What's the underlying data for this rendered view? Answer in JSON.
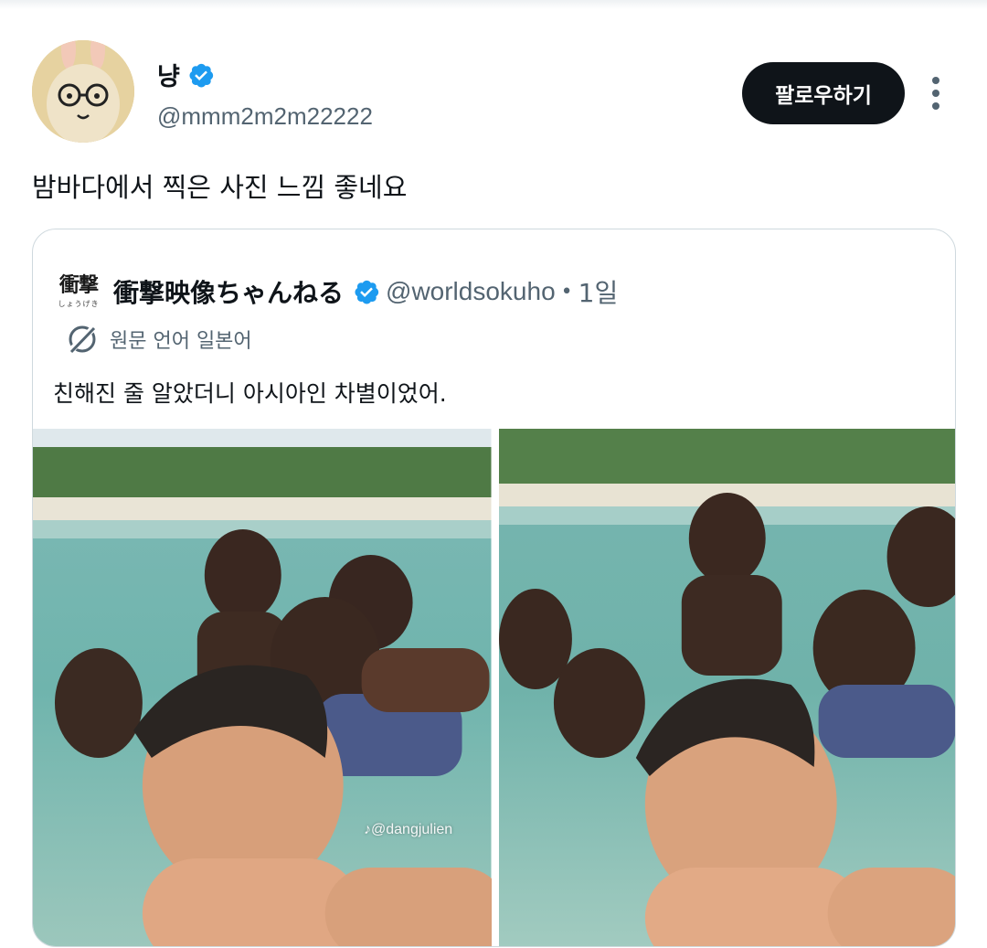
{
  "post": {
    "author_name": "냥",
    "author_handle": "@mmm2m2m22222",
    "follow_label": "팔로우하기",
    "text": "밤바다에서 찍은 사진 느낌 좋네요"
  },
  "quoted": {
    "logo_text": "衝撃",
    "logo_sub": "しょうげき",
    "author_name": "衝撃映像ちゃんねる",
    "author_handle": "@worldsokuho",
    "separator": "•",
    "time": "1일",
    "translate_label": "원문 언어 일본어",
    "text": "친해진 줄 알았더니 아시아인 차별이었어.",
    "media_watermark": "♪@dangjulien"
  },
  "icons": {
    "verified": "verified-badge-icon",
    "more": "more-options-icon",
    "translate": "translate-icon"
  },
  "colors": {
    "verified_blue": "#1d9bf0",
    "primary_text": "#0f1419",
    "secondary_text": "#536471",
    "follow_button": "#0f1419",
    "border": "#cfd9de"
  }
}
